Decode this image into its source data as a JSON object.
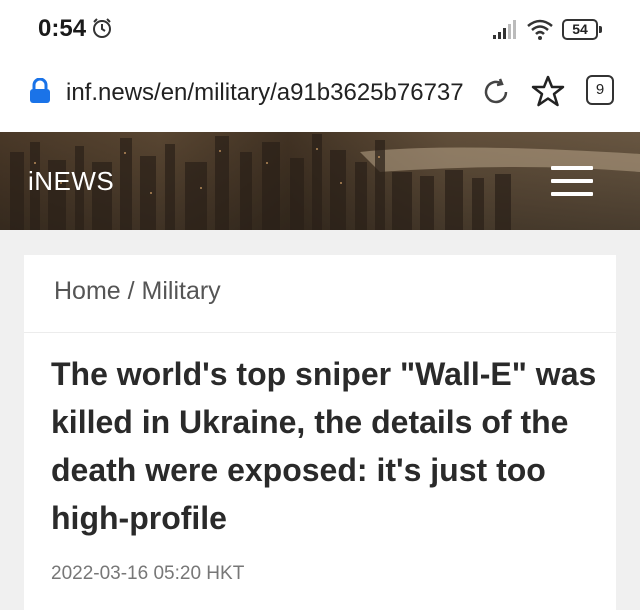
{
  "status_bar": {
    "time": "0:54",
    "battery": "54",
    "icons": [
      "alarm-icon",
      "signal-icon",
      "wifi-icon",
      "battery-icon"
    ]
  },
  "browser": {
    "url": "inf.news/en/military/a91b3625b76737",
    "tab_count": "9",
    "icons": [
      "lock-icon",
      "reload-icon",
      "star-icon",
      "tabs-icon"
    ],
    "lock_color": "#1a73e8"
  },
  "site": {
    "brand": "iNEWS",
    "menu_icon": "hamburger-menu-icon"
  },
  "article": {
    "breadcrumb": "Home / Military",
    "title": "The world's top sniper \"Wall-E\" was killed in Ukraine, the details of the death were exposed: it's just too high-profile",
    "date": "2022-03-16 05:20 HKT"
  }
}
